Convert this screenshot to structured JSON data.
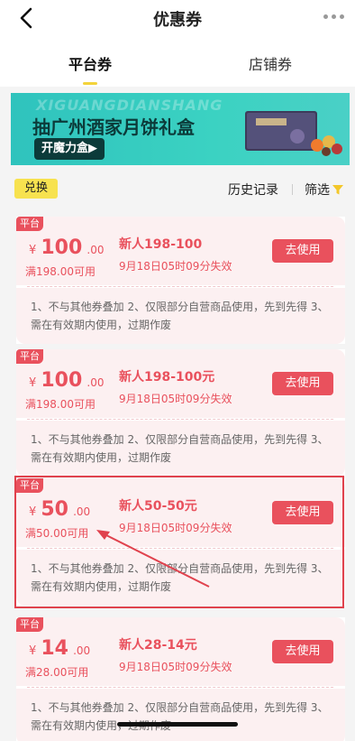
{
  "header": {
    "title": "优惠券"
  },
  "tabs": [
    {
      "label": "平台券",
      "active": true
    },
    {
      "label": "店铺券",
      "active": false
    }
  ],
  "banner": {
    "watermark": "XIGUANGDIANSHANG",
    "title": "抽广州酒家月饼礼盒",
    "button": "开魔力盒▶"
  },
  "actions": {
    "exchange": "兑换",
    "history": "历史记录",
    "filter": "筛选"
  },
  "coupons": [
    {
      "tag": "平台",
      "currency": "¥",
      "amount": "100",
      "decimal": ".00",
      "min": "满198.00可用",
      "name": "新人198-100",
      "expiry": "9月18日05时09分失效",
      "button": "去使用",
      "rules": "1、不与其他券叠加 2、仅限部分自营商品使用，先到先得 3、需在有效期内使用，过期作废"
    },
    {
      "tag": "平台",
      "currency": "¥",
      "amount": "100",
      "decimal": ".00",
      "min": "满198.00可用",
      "name": "新人198-100元",
      "expiry": "9月18日05时09分失效",
      "button": "去使用",
      "rules": "1、不与其他券叠加 2、仅限部分自营商品使用，先到先得 3、需在有效期内使用，过期作废"
    },
    {
      "tag": "平台",
      "currency": "¥",
      "amount": "50",
      "decimal": ".00",
      "min": "满50.00可用",
      "name": "新人50-50元",
      "expiry": "9月18日05时09分失效",
      "button": "去使用",
      "rules": "1、不与其他券叠加 2、仅限部分自营商品使用，先到先得 3、需在有效期内使用，过期作废"
    },
    {
      "tag": "平台",
      "currency": "¥",
      "amount": "14",
      "decimal": ".00",
      "min": "满28.00可用",
      "name": "新人28-14元",
      "expiry": "9月18日05时09分失效",
      "button": "去使用",
      "rules": "1、不与其他券叠加 2、仅限部分自营商品使用，先到先得 3、需在有效期内使用，过期作废"
    }
  ],
  "colors": {
    "accent": "#e9515d",
    "tab_indicator": "#f3d33a",
    "banner": "#3bd2c2"
  }
}
